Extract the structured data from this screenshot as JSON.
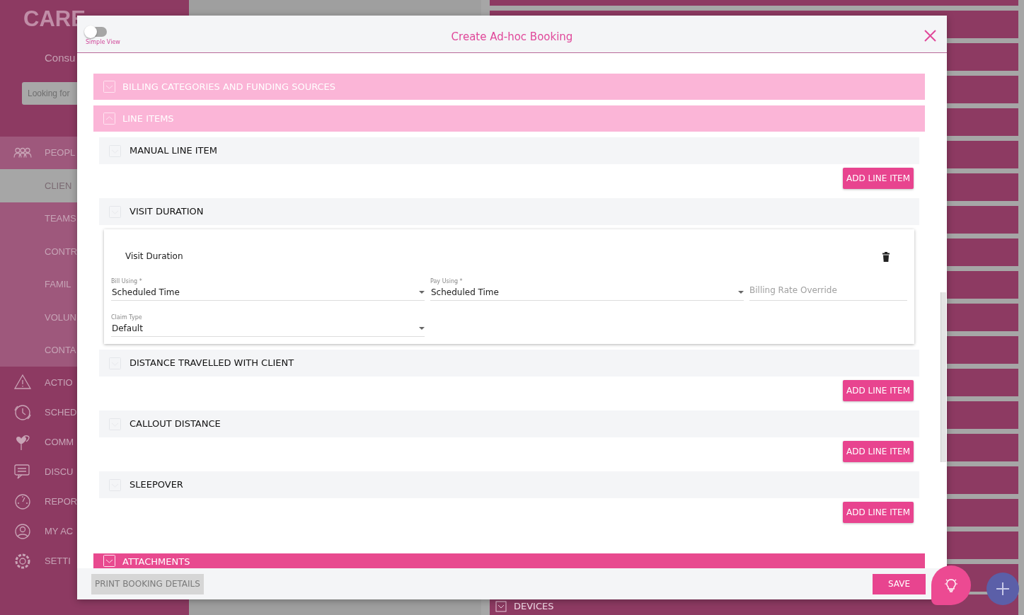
{
  "sidebar": {
    "logo": "CARE",
    "subtitle": "Consu",
    "search": {
      "placeholder": "Looking for"
    },
    "items": [
      {
        "label": "PEOPL",
        "expanded": true,
        "children": [
          {
            "label": "CLIEN",
            "selected": true
          },
          {
            "label": "TEAMS",
            "selected": false
          },
          {
            "label": "CONTR",
            "selected": false
          },
          {
            "label": "FAMIL",
            "selected": false
          },
          {
            "label": "VOLUN",
            "selected": false
          },
          {
            "label": "CONTA",
            "selected": false
          }
        ]
      },
      {
        "label": "ACTIO"
      },
      {
        "label": "SCHED"
      },
      {
        "label": "COMM"
      },
      {
        "label": "DISCU"
      },
      {
        "label": "REPOR"
      },
      {
        "label": "MY AC"
      },
      {
        "label": "SETTI"
      }
    ]
  },
  "background": {
    "list_items": [
      "DEVICES"
    ]
  },
  "modal": {
    "title": "Create Ad-hoc Booking",
    "simple_view": {
      "label": "Simple View",
      "on": false
    },
    "sections": [
      {
        "title": "BILLING CATEGORIES AND FUNDING SOURCES",
        "expanded": false
      },
      {
        "title": "LINE ITEMS",
        "expanded": true,
        "items": [
          {
            "title": "MANUAL LINE ITEM",
            "button": "ADD LINE ITEM"
          },
          {
            "title": "VISIT DURATION",
            "detail": {
              "title": "Visit Duration",
              "fields": [
                {
                  "label": "Bill Using *",
                  "value": "Scheduled Time",
                  "kind": "select"
                },
                {
                  "label": "Pay Using *",
                  "value": "Scheduled Time",
                  "kind": "select"
                },
                {
                  "placeholder": "Billing Rate Override",
                  "kind": "text"
                },
                {
                  "label": "Claim Type",
                  "value": "Default",
                  "kind": "select"
                }
              ]
            }
          },
          {
            "title": "DISTANCE TRAVELLED WITH CLIENT",
            "button": "ADD LINE ITEM"
          },
          {
            "title": "CALLOUT DISTANCE",
            "button": "ADD LINE ITEM"
          },
          {
            "title": "SLEEPOVER",
            "button": "ADD LINE ITEM"
          }
        ]
      },
      {
        "title": "ATTACHMENTS",
        "expanded": false,
        "kind": "strong"
      }
    ],
    "footer": {
      "print_button": "PRINT BOOKING DETAILS",
      "save_button": "SAVE"
    }
  }
}
